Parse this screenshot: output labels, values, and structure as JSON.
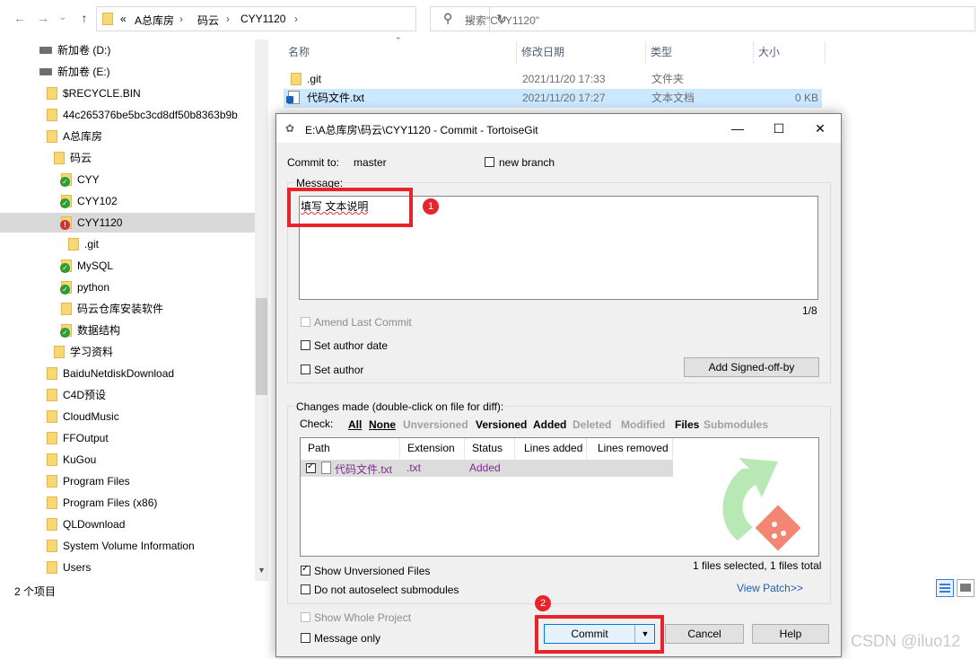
{
  "explorer": {
    "address": {
      "chevrons": "«",
      "segments": [
        "A总库房",
        "码云",
        "CYY1120"
      ]
    },
    "search_placeholder": "搜索\"CYY1120\"",
    "tree": [
      {
        "label": "新加卷 (D:)",
        "kind": "drive"
      },
      {
        "label": "新加卷 (E:)",
        "kind": "drive"
      },
      {
        "label": "$RECYCLE.BIN",
        "kind": "folder"
      },
      {
        "label": "44c265376be5bc3cd8df50b8363b9b",
        "kind": "folder"
      },
      {
        "label": "A总库房",
        "kind": "folder"
      },
      {
        "label": "码云",
        "kind": "folder"
      },
      {
        "label": "CYY",
        "kind": "folder-ok"
      },
      {
        "label": "CYY102",
        "kind": "folder-ok"
      },
      {
        "label": "CYY1120",
        "kind": "folder-err"
      },
      {
        "label": ".git",
        "kind": "folder"
      },
      {
        "label": "MySQL",
        "kind": "folder-ok"
      },
      {
        "label": "python",
        "kind": "folder-ok"
      },
      {
        "label": "码云仓库安装软件",
        "kind": "folder"
      },
      {
        "label": "数据结构",
        "kind": "folder-ok"
      },
      {
        "label": "学习资料",
        "kind": "folder"
      },
      {
        "label": "BaiduNetdiskDownload",
        "kind": "folder"
      },
      {
        "label": "C4D预设",
        "kind": "folder"
      },
      {
        "label": "CloudMusic",
        "kind": "folder"
      },
      {
        "label": "FFOutput",
        "kind": "folder"
      },
      {
        "label": "KuGou",
        "kind": "folder"
      },
      {
        "label": "Program Files",
        "kind": "folder"
      },
      {
        "label": "Program Files (x86)",
        "kind": "folder"
      },
      {
        "label": "QLDownload",
        "kind": "folder"
      },
      {
        "label": "System Volume Information",
        "kind": "folder"
      },
      {
        "label": "Users",
        "kind": "folder"
      }
    ],
    "columns": {
      "name": "名称",
      "date": "修改日期",
      "type": "类型",
      "size": "大小"
    },
    "files": [
      {
        "name": ".git",
        "date": "2021/11/20 17:33",
        "type": "文件夹",
        "size": ""
      },
      {
        "name": "代码文件.txt",
        "date": "2021/11/20 17:27",
        "type": "文本文档",
        "size": "0 KB"
      }
    ],
    "status": "2 个项目"
  },
  "dialog": {
    "title": "E:\\A总库房\\码云\\CYY1120 - Commit - TortoiseGit",
    "commit_to_label": "Commit to:",
    "branch": "master",
    "new_branch_label": "new branch",
    "message_label": "Message:",
    "message_text": "填写 文本说明",
    "counter": "1/8",
    "amend_label": "Amend Last Commit",
    "set_author_date_label": "Set author date",
    "set_author_label": "Set author",
    "signed_off_button": "Add Signed-off-by",
    "changes_label": "Changes made (double-click on file for diff):",
    "check_label": "Check:",
    "check_filters": [
      {
        "label": "All",
        "enabled": true
      },
      {
        "label": "None",
        "enabled": true
      },
      {
        "label": "Unversioned",
        "enabled": false
      },
      {
        "label": "Versioned",
        "enabled": true
      },
      {
        "label": "Added",
        "enabled": true
      },
      {
        "label": "Deleted",
        "enabled": false
      },
      {
        "label": "Modified",
        "enabled": false
      },
      {
        "label": "Files",
        "enabled": true
      },
      {
        "label": "Submodules",
        "enabled": false
      }
    ],
    "list_columns": [
      "Path",
      "Extension",
      "Status",
      "Lines added",
      "Lines removed"
    ],
    "list_rows": [
      {
        "path": "代码文件.txt",
        "extension": ".txt",
        "status": "Added",
        "added": "",
        "removed": ""
      }
    ],
    "show_unversioned_label": "Show Unversioned Files",
    "no_autoselect_label": "Do not autoselect submodules",
    "selection_summary": "1 files selected, 1 files total",
    "view_patch": "View Patch>>",
    "show_whole_project_label": "Show Whole Project",
    "message_only_label": "Message only",
    "commit_button": "Commit",
    "cancel_button": "Cancel",
    "help_button": "Help",
    "annotations": [
      "1",
      "2"
    ]
  },
  "watermark": "CSDN @iluo12",
  "colors": {
    "highlight": "#e8242b",
    "selection": "#cce8ff",
    "link": "#1a5fb4",
    "added_text": "#7a2e8c"
  }
}
